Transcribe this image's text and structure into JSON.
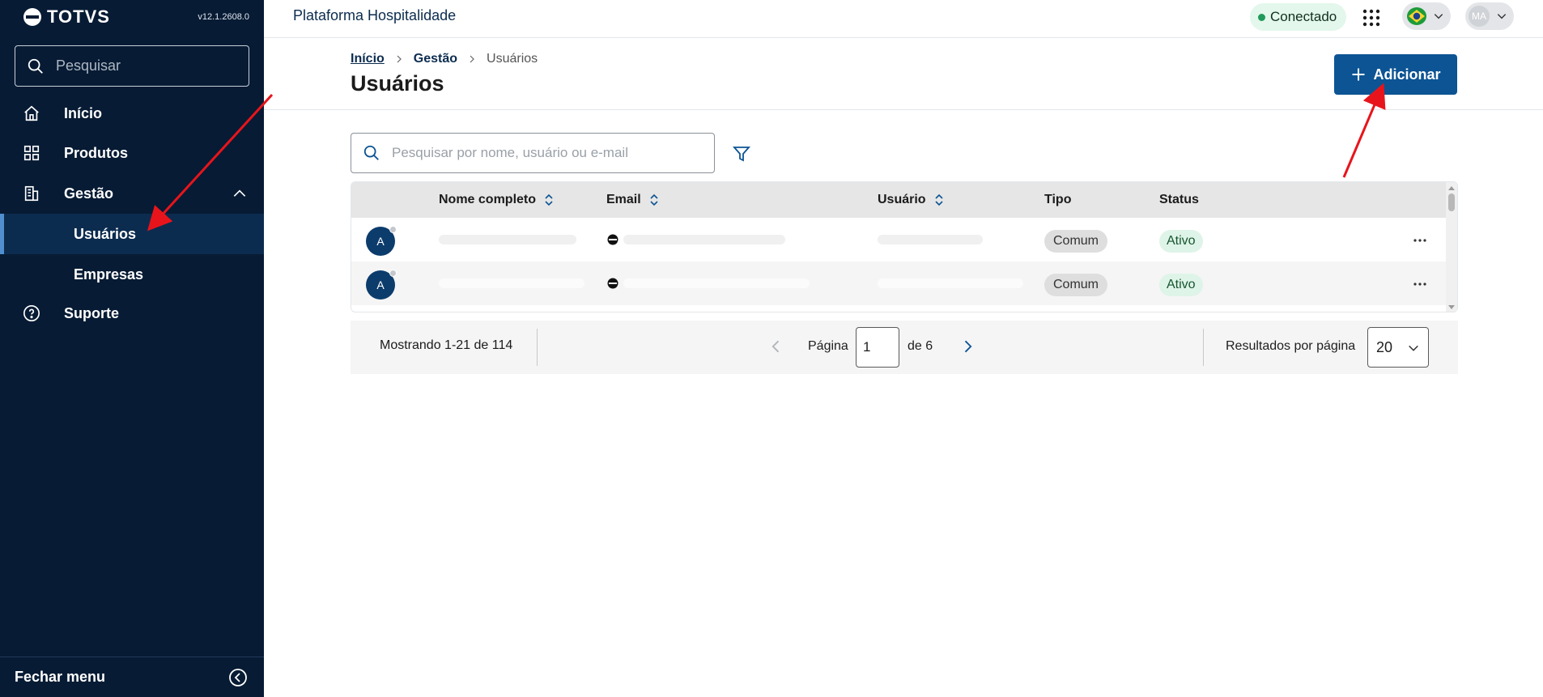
{
  "sidebar": {
    "brand": "TOTVS",
    "version": "v12.1.2608.0",
    "search_placeholder": "Pesquisar",
    "items": [
      {
        "label": "Início",
        "icon": "home-icon"
      },
      {
        "label": "Produtos",
        "icon": "grid-icon"
      },
      {
        "label": "Gestão",
        "icon": "building-icon",
        "expanded": true
      },
      {
        "label": "Suporte",
        "icon": "help-icon"
      }
    ],
    "subitems": [
      {
        "label": "Usuários",
        "active": true
      },
      {
        "label": "Empresas",
        "active": false
      }
    ],
    "close_menu": "Fechar menu"
  },
  "topbar": {
    "app_title": "Plataforma Hospitalidade",
    "status": "Conectado",
    "user_initials": "MA"
  },
  "header": {
    "breadcrumb": [
      "Início",
      "Gestão",
      "Usuários"
    ],
    "title": "Usuários",
    "add_button": "Adicionar"
  },
  "search": {
    "placeholder": "Pesquisar por nome, usuário ou e-mail"
  },
  "table": {
    "columns": [
      "Nome completo",
      "Email",
      "Usuário",
      "Tipo",
      "Status"
    ],
    "rows": [
      {
        "avatar": "A",
        "tipo": "Comum",
        "status": "Ativo"
      },
      {
        "avatar": "A",
        "tipo": "Comum",
        "status": "Ativo"
      }
    ]
  },
  "pagination": {
    "showing": "Mostrando 1-21 de 114",
    "page_label": "Página",
    "current_page": "1",
    "of_label": "de 6",
    "per_page_label": "Resultados por página",
    "per_page": "20"
  },
  "colors": {
    "sidebar_bg": "#071b34",
    "primary": "#0c5494",
    "status_green": "#1f9a5a",
    "annotation": "#e8141b"
  }
}
